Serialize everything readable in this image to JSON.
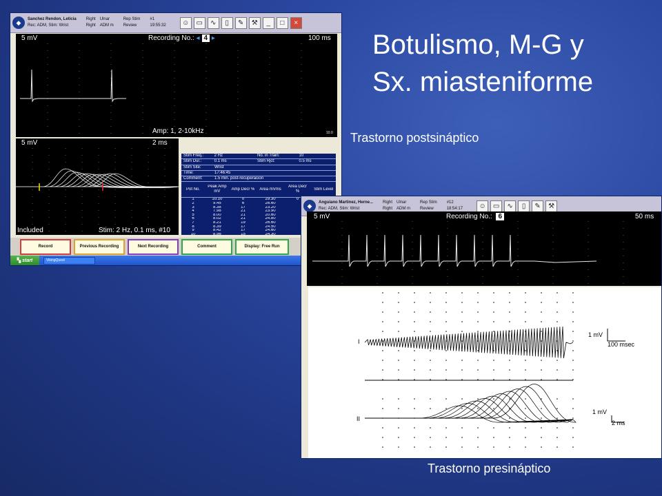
{
  "slide": {
    "title_line1": "Botulismo, M-G y",
    "title_line2": "Sx. miasteniforme",
    "caption_post": "Trastorno postsináptico",
    "caption_pre": "Trastorno presináptico"
  },
  "win1": {
    "patient": "Sanchez Rendon, Leticia",
    "rec": "Rec: ADM, Stim: Wrist",
    "side1": "Right",
    "nerve1": "Ulnar",
    "side2": "Right",
    "nerve2": "ADM m",
    "mode": "Rep Stim",
    "status": "Review",
    "index": "#1",
    "time": "19:55:32",
    "trace1": {
      "sensitivity": "5 mV",
      "recording_label": "Recording No.:",
      "recording_no": "4",
      "sweep": "100 ms",
      "amp": "Amp: 1, 2-10kHz",
      "scale_mark": "10.0"
    },
    "trace2": {
      "sensitivity": "5 mV",
      "sweep": "2 ms",
      "included": "Included",
      "stim": "Stim:   2 Hz, 0.1 ms, #10"
    },
    "params": [
      [
        "Stim Freq.:",
        "2 Hz",
        "No. in Train:",
        "10"
      ],
      [
        "Stim Dur.:",
        "0.1 ms",
        "Stim Rjct:",
        "0.5 ms"
      ],
      [
        "Stim Site:",
        "Wrist",
        "",
        ""
      ],
      [
        "Time:",
        "17:46:45",
        "",
        ""
      ],
      [
        "Comment:",
        "1.5 min. post-recuperacion",
        "",
        ""
      ]
    ],
    "table_headers": [
      "Pot No.",
      "Peak Amp mV",
      "Amp Decr %",
      "Area mVms",
      "Area Decr %",
      "Stim Level"
    ],
    "table_rows": [
      [
        "1",
        "10.10",
        "0",
        "29.30",
        "0",
        "100V"
      ],
      [
        "2",
        "9.45",
        "6",
        "26.60",
        "",
        ""
      ],
      [
        "3",
        "8.38",
        "17",
        "23.20",
        "",
        ""
      ],
      [
        "4",
        "7.98",
        "21",
        "23.90",
        "",
        ""
      ],
      [
        "5",
        "8.00",
        "21",
        "20.60",
        "",
        ""
      ],
      [
        "6",
        "8.02",
        "21",
        "24.80",
        "",
        ""
      ],
      [
        "7",
        "8.21",
        "19",
        "26.60",
        "",
        ""
      ],
      [
        "8",
        "8.39",
        "17",
        "24.50",
        "",
        ""
      ],
      [
        "9",
        "8.42",
        "17",
        "24.60",
        "",
        ""
      ],
      [
        "10",
        "8.56",
        "15",
        "24.30",
        "",
        ""
      ]
    ],
    "buttons": {
      "record": "Record",
      "previous": "Previous Recording",
      "next": "Next Recording",
      "comment": "Comment",
      "display": "Display: Free Run"
    },
    "taskbar": {
      "start": "start",
      "app": "VikingQuest"
    }
  },
  "win2": {
    "patient": "Anguiano Martinez, Herne...",
    "rec": "Rec: ADM, Stim: Wrist",
    "side1": "Right",
    "nerve1": "Ulnar",
    "side2": "Right",
    "nerve2": "ADM m",
    "mode": "Rep Stim",
    "status": "Review",
    "index": "#12",
    "time": "18:54:17",
    "trace": {
      "sensitivity": "5 mV",
      "recording_label": "Recording No.:",
      "recording_no": "6",
      "sweep": "50 ms"
    },
    "figure": {
      "label_i": "I",
      "label_ii": "II",
      "scale1_amp": "1 mV",
      "scale1_time": "100 msec",
      "scale2_amp": "1 mV",
      "scale2_time": "2 ms"
    }
  },
  "colors": {
    "background": "#2a47a0",
    "scope_bg": "#000000",
    "trace": "#e8e8e8",
    "table_bg": "#0c1e6e",
    "button_border": "#c03a8a"
  }
}
